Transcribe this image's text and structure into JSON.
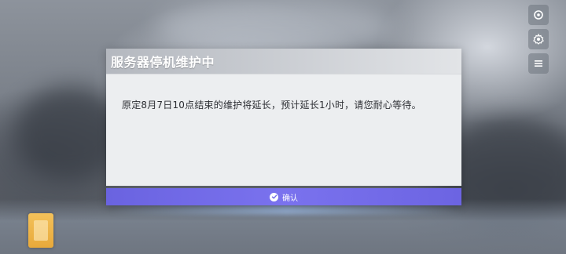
{
  "dialog": {
    "title": "服务器停机维护中",
    "message": "原定8月7日10点结束的维护将延长，预计延长1小时，请您耐心等待。",
    "confirm_label": "确认"
  },
  "side_icons": [
    "settings-icon",
    "gear-icon",
    "menu-icon"
  ],
  "colors": {
    "accent": "#7068e6",
    "dialog_bg": "#eceef0",
    "header_bg": "#c4c7cc"
  }
}
